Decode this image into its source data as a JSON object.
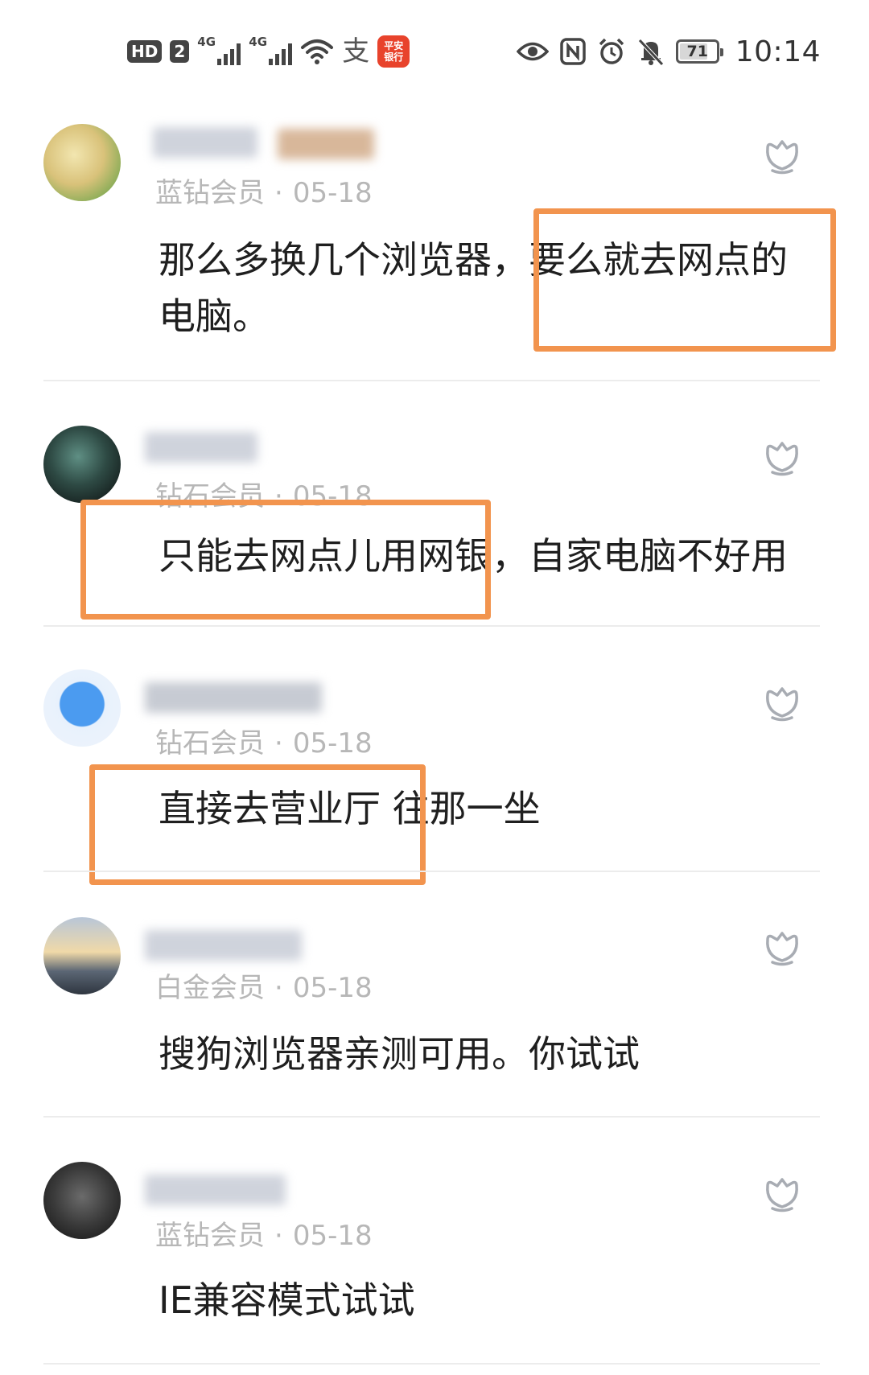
{
  "status_bar": {
    "hd": "HD",
    "sim": "2",
    "network_1": "4G",
    "network_2": "4G",
    "pay_glyph": "支",
    "bank_app_line1": "平安",
    "bank_app_line2": "银行",
    "battery": "71",
    "time": "10:14",
    "icons": [
      "hd-icon",
      "sim-icon",
      "signal-icon",
      "signal-icon",
      "wifi-icon",
      "alipay-icon",
      "bank-app-icon",
      "eye-icon",
      "nfc-icon",
      "alarm-icon",
      "mute-icon",
      "battery-icon"
    ]
  },
  "comments": [
    {
      "level": "蓝钻会员",
      "date": "05-18",
      "lines": [
        "那么多换几个浏览器，要么就去网点的",
        "电脑。"
      ],
      "like_icon": "like-icon"
    },
    {
      "level": "钻石会员",
      "date": "05-18",
      "lines": [
        "只能去网点儿用网银，自家电脑不好用"
      ],
      "like_icon": "like-icon"
    },
    {
      "level": "钻石会员",
      "date": "05-18",
      "lines": [
        "直接去营业厅 往那一坐"
      ],
      "like_icon": "like-icon"
    },
    {
      "level": "白金会员",
      "date": "05-18",
      "lines": [
        "搜狗浏览器亲测可用。你试试"
      ],
      "like_icon": "like-icon"
    },
    {
      "level": "蓝钻会员",
      "date": "05-18",
      "lines": [
        "IE兼容模式试试"
      ],
      "like_icon": "like-icon"
    }
  ],
  "meta_separator": "·",
  "highlight_color": "#f2944e"
}
